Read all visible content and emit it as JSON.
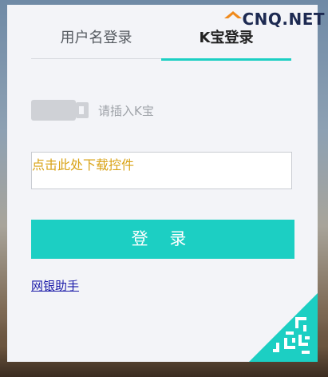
{
  "tabs": {
    "username_label": "用户名登录",
    "kbao_label": "K宝登录"
  },
  "usbkey": {
    "icon": "usb-key-icon",
    "hint": "请插入K宝"
  },
  "download": {
    "link_text": "点击此处下载控件"
  },
  "login": {
    "button_label": "登 录"
  },
  "helper": {
    "link_text": "网银助手"
  },
  "corner": {
    "icon": "qr-code-icon"
  },
  "watermark": {
    "text": "CNQ.NET",
    "icon": "orange-roof-logo"
  },
  "colors": {
    "accent": "#1ccfc3",
    "download_text": "#d9a316",
    "link": "#1a1aa8",
    "panel_bg": "#f3f4f8"
  }
}
